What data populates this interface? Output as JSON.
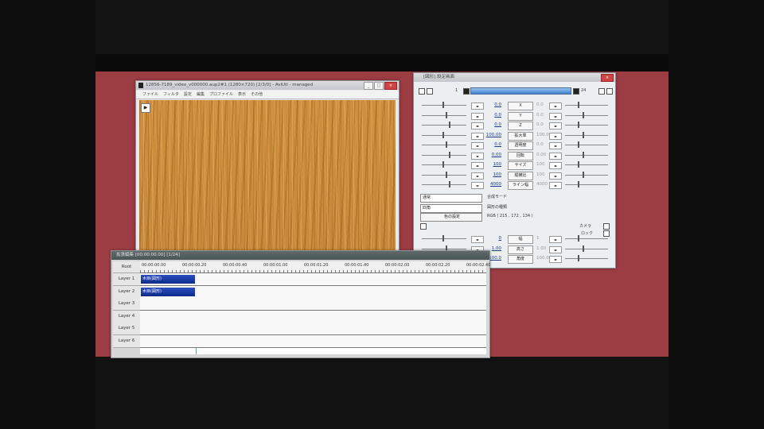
{
  "preview": {
    "title": "12856-7189_video_v000000.aup2#1 (1280×720) [2/3/0] - AviUtl - managed",
    "menu": [
      "ファイル",
      "フィルタ",
      "設定",
      "編集",
      "プロファイル",
      "表示",
      "その他"
    ],
    "play_glyph": "▶"
  },
  "settings": {
    "title": "[図形] 設定画面",
    "frame_start": "1",
    "frame_end": "24",
    "rows": [
      {
        "value": "0.0",
        "button": "X",
        "value2": "0.0"
      },
      {
        "value": "0.0",
        "button": "Y",
        "value2": "0.0"
      },
      {
        "value": "0.0",
        "button": "Z",
        "value2": "0.0"
      },
      {
        "value": "100.00",
        "button": "拡大率",
        "value2": "100.00"
      },
      {
        "value": "0.0",
        "button": "透明度",
        "value2": "0.0"
      },
      {
        "value": "0.00",
        "button": "回転",
        "value2": "0.00"
      },
      {
        "value": "100",
        "button": "サイズ",
        "value2": "100"
      },
      {
        "value": "100",
        "button": "縦横比",
        "value2": "100"
      },
      {
        "value": "4000",
        "button": "ライン幅",
        "value2": "4000"
      }
    ],
    "blend_select": "通常",
    "figure_select": "四角",
    "color_button": "色の設定",
    "label_blend": "合成モード",
    "label_figure": "図形の種類",
    "rgb_text": "RGB ( 215 , 172 , 134 )",
    "camera_label": "カメラ",
    "lock_label": "ロック",
    "lower_rows": [
      {
        "value": "0",
        "button": "幅",
        "value2": "1"
      },
      {
        "value": "1.00",
        "button": "高さ",
        "value2": "1.00"
      },
      {
        "value": "100.0",
        "button": "角度",
        "value2": "100.0"
      }
    ]
  },
  "timeline": {
    "title": "拡張編集 [00:00:00.00] [1/24]",
    "root_label": "Root",
    "ruler_ticks": [
      "00:00:00.00",
      "00:00:00.20",
      "00:00:00.40",
      "00:00:01.00",
      "00:00:01.20",
      "00:00:01.40",
      "00:00:02.00",
      "00:00:02.20",
      "00:00:02.40"
    ],
    "layers": [
      "Layer 1",
      "Layer 2",
      "Layer 3",
      "Layer 4",
      "Layer 5",
      "Layer 6"
    ],
    "clips": [
      {
        "layer": 1,
        "label": "木目(図形)"
      },
      {
        "layer": 2,
        "label": "木目(図形)"
      }
    ]
  }
}
